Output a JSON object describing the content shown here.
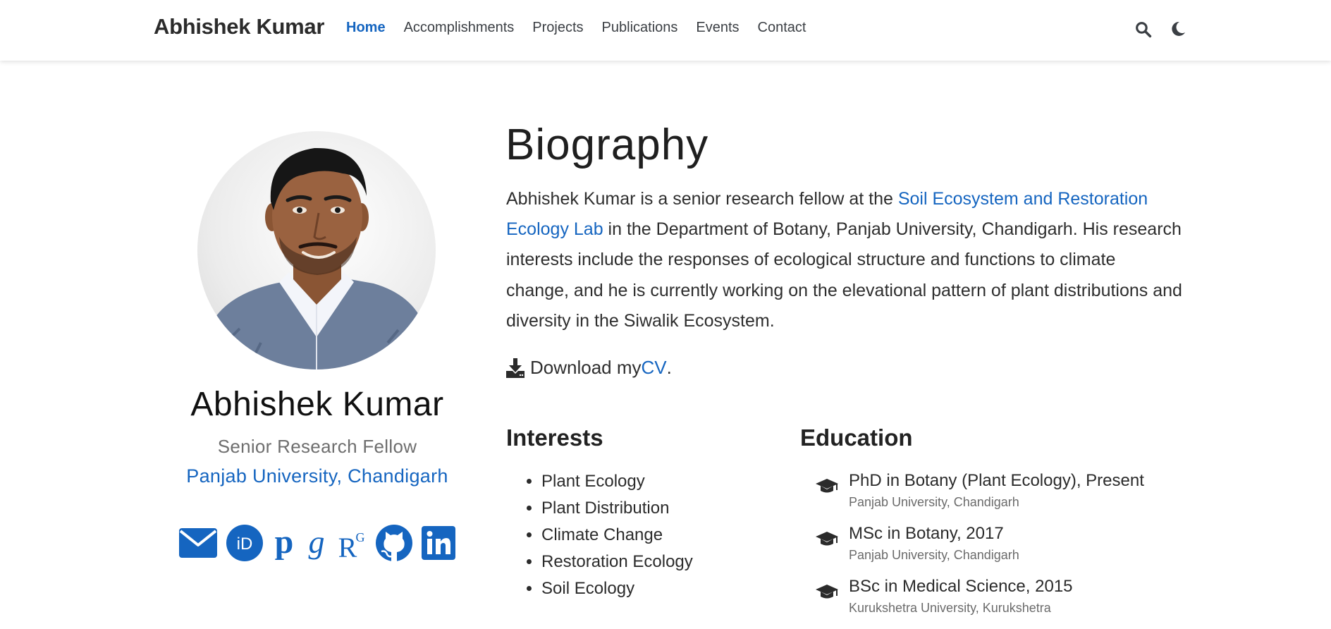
{
  "navbar": {
    "brand": "Abhishek Kumar",
    "links": [
      {
        "label": "Home",
        "active": true
      },
      {
        "label": "Accomplishments"
      },
      {
        "label": "Projects"
      },
      {
        "label": "Publications"
      },
      {
        "label": "Events"
      },
      {
        "label": "Contact"
      }
    ],
    "icons": [
      "search-icon",
      "moon-icon"
    ]
  },
  "profile": {
    "name": "Abhishek Kumar",
    "role": "Senior Research Fellow",
    "organization": "Panjab University, Chandigarh",
    "social_icons": [
      "envelope-icon",
      "orcid-icon",
      "publons-icon",
      "google-scholar-icon",
      "researchgate-icon",
      "github-icon",
      "linkedin-icon"
    ]
  },
  "biography": {
    "title": "Biography",
    "text_before_link": "Abhishek Kumar is a senior research fellow at the ",
    "lab_link": "Soil Ecosystem and Restoration Ecology Lab",
    "text_after_link": " in the Department of Botany, Panjab University, Chandigarh. His research interests include the responses of ecological structure and functions to climate change, and he is currently working on the elevational pattern of plant distributions and diversity in the Siwalik Ecosystem.",
    "cv_prefix": "Download my ",
    "cv_link": "CV",
    "cv_suffix": "."
  },
  "interests": {
    "title": "Interests",
    "items": [
      "Plant Ecology",
      "Plant Distribution",
      "Climate Change",
      "Restoration Ecology",
      "Soil Ecology"
    ]
  },
  "education": {
    "title": "Education",
    "items": [
      {
        "course": "PhD in Botany (Plant Ecology), Present",
        "institution": "Panjab University, Chandigarh"
      },
      {
        "course": "MSc in Botany, 2017",
        "institution": "Panjab University, Chandigarh"
      },
      {
        "course": "BSc in Medical Science, 2015",
        "institution": "Kurukshetra University, Kurukshetra"
      }
    ]
  },
  "colors": {
    "accent": "#1565c0",
    "text": "#2b2b2b",
    "muted": "#6e6e6e",
    "navbar_bg": "#ffffff"
  }
}
